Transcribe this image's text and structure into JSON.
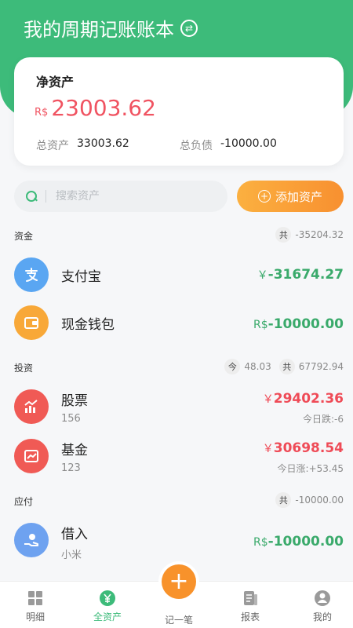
{
  "header": {
    "title": "我的周期记账账本"
  },
  "card": {
    "title": "净资产",
    "net_currency": "R$",
    "net_value": "23003.62",
    "total_assets_label": "总资产",
    "total_assets_value": "33003.62",
    "total_liabilities_label": "总负债",
    "total_liabilities_value": "-10000.00"
  },
  "search": {
    "placeholder": "搜索资产"
  },
  "add_button": {
    "label": "添加资产"
  },
  "sections": {
    "funds": {
      "label": "资金",
      "total_pill": "共",
      "total": "-35204.32",
      "items": [
        {
          "name": "支付宝",
          "currency": "￥",
          "amount": "-31674.27"
        },
        {
          "name": "现金钱包",
          "currency": "R$",
          "amount": "-10000.00"
        }
      ]
    },
    "investments": {
      "label": "投资",
      "today_pill": "今",
      "today": "48.03",
      "total_pill": "共",
      "total": "67792.94",
      "items": [
        {
          "name": "股票",
          "sub": "156",
          "currency": "￥",
          "amount": "29402.36",
          "note": "今日跌:-6"
        },
        {
          "name": "基金",
          "sub": "123",
          "currency": "￥",
          "amount": "30698.54",
          "note": "今日涨:+53.45"
        }
      ]
    },
    "payables": {
      "label": "应付",
      "total_pill": "共",
      "total": "-10000.00",
      "items": [
        {
          "name": "借入",
          "sub": "小米",
          "currency": "R$",
          "amount": "-10000.00"
        }
      ]
    }
  },
  "tabbar": {
    "items": [
      {
        "label": "明细"
      },
      {
        "label": "全资产"
      },
      {
        "label": "记一笔"
      },
      {
        "label": "报表"
      },
      {
        "label": "我的"
      }
    ]
  },
  "colors": {
    "brand": "#3dbb7a",
    "accent": "#f8922b",
    "negative": "#3aaa6b",
    "positive": "#ef4b57"
  }
}
